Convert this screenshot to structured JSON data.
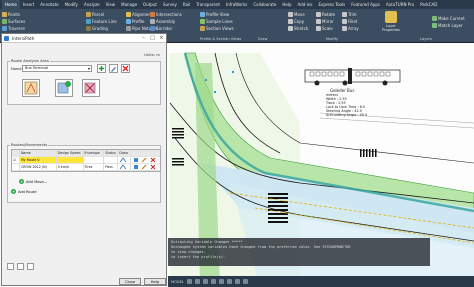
{
  "ribbon": {
    "tabs": [
      "Home",
      "Insert",
      "Annotate",
      "Modify",
      "Analyze",
      "View",
      "Manage",
      "Output",
      "Survey",
      "Rail",
      "Transparent",
      "InfraWorks",
      "Collaborate",
      "Help",
      "Add-ins",
      "Express Tools",
      "Featured Apps",
      "AutoTURN Pro",
      "ParkCAD"
    ],
    "active_tab": "Home",
    "create_ground_data": [
      "Points",
      "Surfaces",
      "Traverse"
    ],
    "parcel_group": [
      "Parcel",
      "Feature Line",
      "Grading"
    ],
    "intersections_group": [
      "Intersections",
      "Assembly",
      "Corridor"
    ],
    "alignment_group": [
      "Alignment",
      "Profile",
      "Pipe Network"
    ],
    "profile_views": [
      "Profile View",
      "Sample Lines",
      "Section Views"
    ],
    "draw": [
      "Move",
      "Copy",
      "Stretch",
      "Rotate",
      "Mirror",
      "Scale",
      "Trim",
      "Fillet",
      "Array"
    ],
    "layers": [
      "Layer Properties",
      "Make Current",
      "Match Layer"
    ],
    "panel_title_profile": "Profile & Section Views",
    "panel_title_draw": "Draw",
    "panel_title_modify": "Modify",
    "panel_title_layers": "Layers"
  },
  "dialog": {
    "title": "IntersiPath",
    "units": "Units: m",
    "route_analysis_area": "Route Analysis Area",
    "name_label": "Name:",
    "name_value": "Bus Terminal",
    "routes_movements": "Routes/Movements",
    "columns": [
      "",
      "Name",
      "Design Speed",
      "Envelope",
      "Status",
      "Draw",
      ""
    ],
    "rows": [
      [
        "☑",
        "My Route 0",
        "",
        "",
        "",
        "",
        ""
      ],
      [
        "",
        "CROW 2012 (N)",
        "5 km/h",
        "Tires",
        "Pass",
        "",
        ""
      ]
    ],
    "add_move": "Add Move...",
    "add_route": "Add Route",
    "close": "Close",
    "help": "Help"
  },
  "drawing": {
    "vehicle_label": "Geleder Bus",
    "vehicle_spec": [
      "meters",
      "Width : 2.55",
      "Track : 2.55",
      "Lock to Lock Time : 6.0",
      "Steering Angle : 42.0",
      "Articulating Angle : 45.0"
    ]
  },
  "cmdline": [
    "Extracting Variable Changes *****",
    "Unchanged system variables have changed from the preferred value. See SYSVARMONITOR",
    "to view changes.",
    "to insert the profile(s):"
  ],
  "status": "MODEL"
}
